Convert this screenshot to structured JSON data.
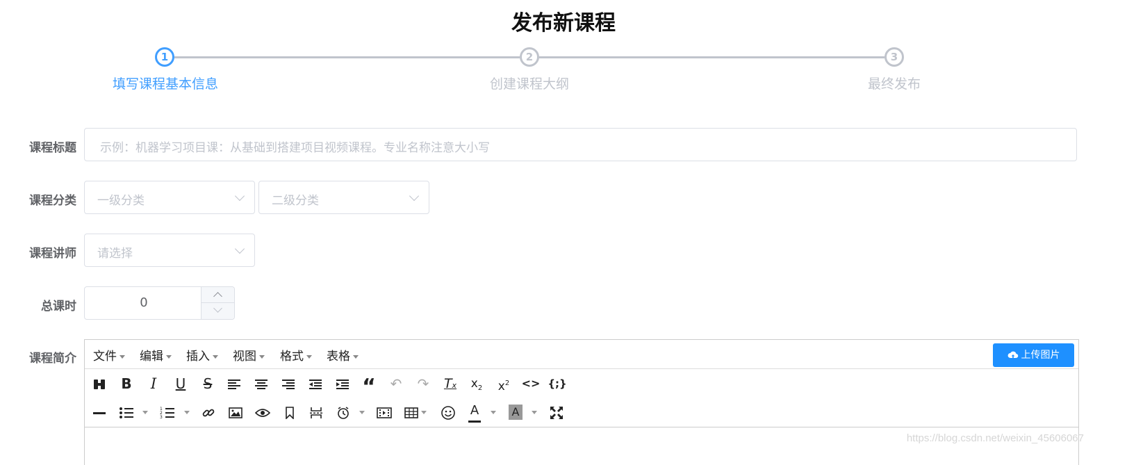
{
  "page": {
    "title": "发布新课程"
  },
  "steps": [
    {
      "number": "1",
      "label": "填写课程基本信息",
      "active": true
    },
    {
      "number": "2",
      "label": "创建课程大纲",
      "active": false
    },
    {
      "number": "3",
      "label": "最终发布",
      "active": false
    }
  ],
  "form": {
    "title_label": "课程标题",
    "title_placeholder": "示例：机器学习项目课：从基础到搭建项目视频课程。专业名称注意大小写",
    "category_label": "课程分类",
    "category_level1_placeholder": "一级分类",
    "category_level2_placeholder": "二级分类",
    "teacher_label": "课程讲师",
    "teacher_placeholder": "请选择",
    "lesson_num_label": "总课时",
    "lesson_num_value": "0",
    "description_label": "课程简介"
  },
  "editor": {
    "menus": [
      "文件",
      "编辑",
      "插入",
      "视图",
      "格式",
      "表格"
    ],
    "upload_label": "上传图片",
    "toolbar_row1": [
      "find-replace",
      "bold",
      "italic",
      "underline",
      "strikethrough",
      "align-left",
      "align-center",
      "align-right",
      "outdent",
      "indent",
      "blockquote",
      "undo",
      "redo",
      "remove-format",
      "subscript",
      "superscript",
      "code",
      "code-sample"
    ],
    "toolbar_row2": [
      "horizontal-rule",
      "bullet-list",
      "numbered-list",
      "link",
      "image",
      "preview",
      "anchor",
      "page-break",
      "insert-datetime",
      "media",
      "table",
      "emoticons",
      "text-color",
      "background-color",
      "fullscreen"
    ]
  },
  "watermark": "https://blog.csdn.net/weixin_45606067",
  "colors": {
    "accent": "#409eff",
    "upload_button": "#1e90ff",
    "inactive": "#c0c4cc"
  }
}
